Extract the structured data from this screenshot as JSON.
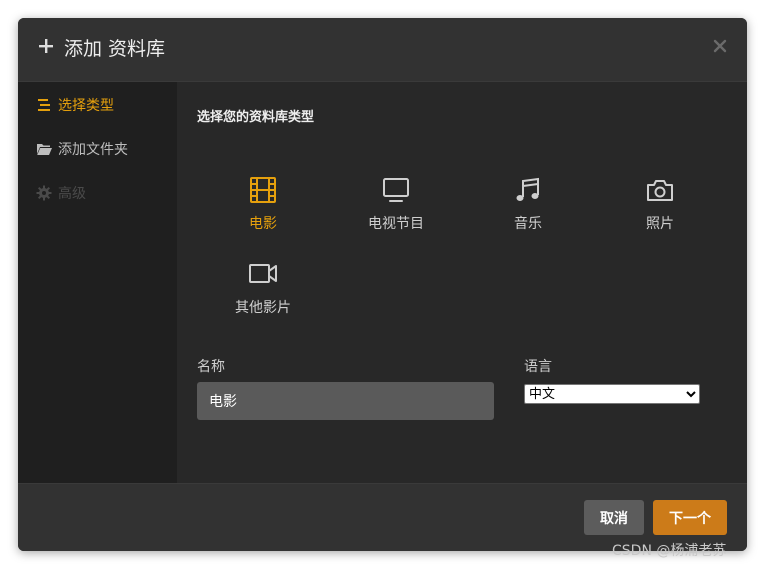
{
  "dialog": {
    "title": "添加 资料库"
  },
  "sidebar": {
    "items": [
      {
        "label": "选择类型",
        "icon": "list-icon",
        "state": "active"
      },
      {
        "label": "添加文件夹",
        "icon": "folder-icon",
        "state": "normal"
      },
      {
        "label": "高级",
        "icon": "gear-icon",
        "state": "disabled"
      }
    ]
  },
  "main": {
    "section_title": "选择您的资料库类型",
    "types": [
      {
        "label": "电影",
        "icon": "film-icon",
        "selected": true
      },
      {
        "label": "电视节目",
        "icon": "tv-icon",
        "selected": false
      },
      {
        "label": "音乐",
        "icon": "music-icon",
        "selected": false
      },
      {
        "label": "照片",
        "icon": "camera-icon",
        "selected": false
      },
      {
        "label": "其他影片",
        "icon": "video-camera-icon",
        "selected": false
      }
    ],
    "name_label": "名称",
    "name_value": "电影",
    "language_label": "语言",
    "language_value": "中文"
  },
  "footer": {
    "cancel_label": "取消",
    "next_label": "下一个"
  },
  "watermark": "CSDN @杨浦老苏",
  "colors": {
    "accent": "#e5a00d",
    "next_button": "#cc7b19",
    "dialog_bg": "#282828",
    "sidebar_bg": "#1f1f1f"
  }
}
